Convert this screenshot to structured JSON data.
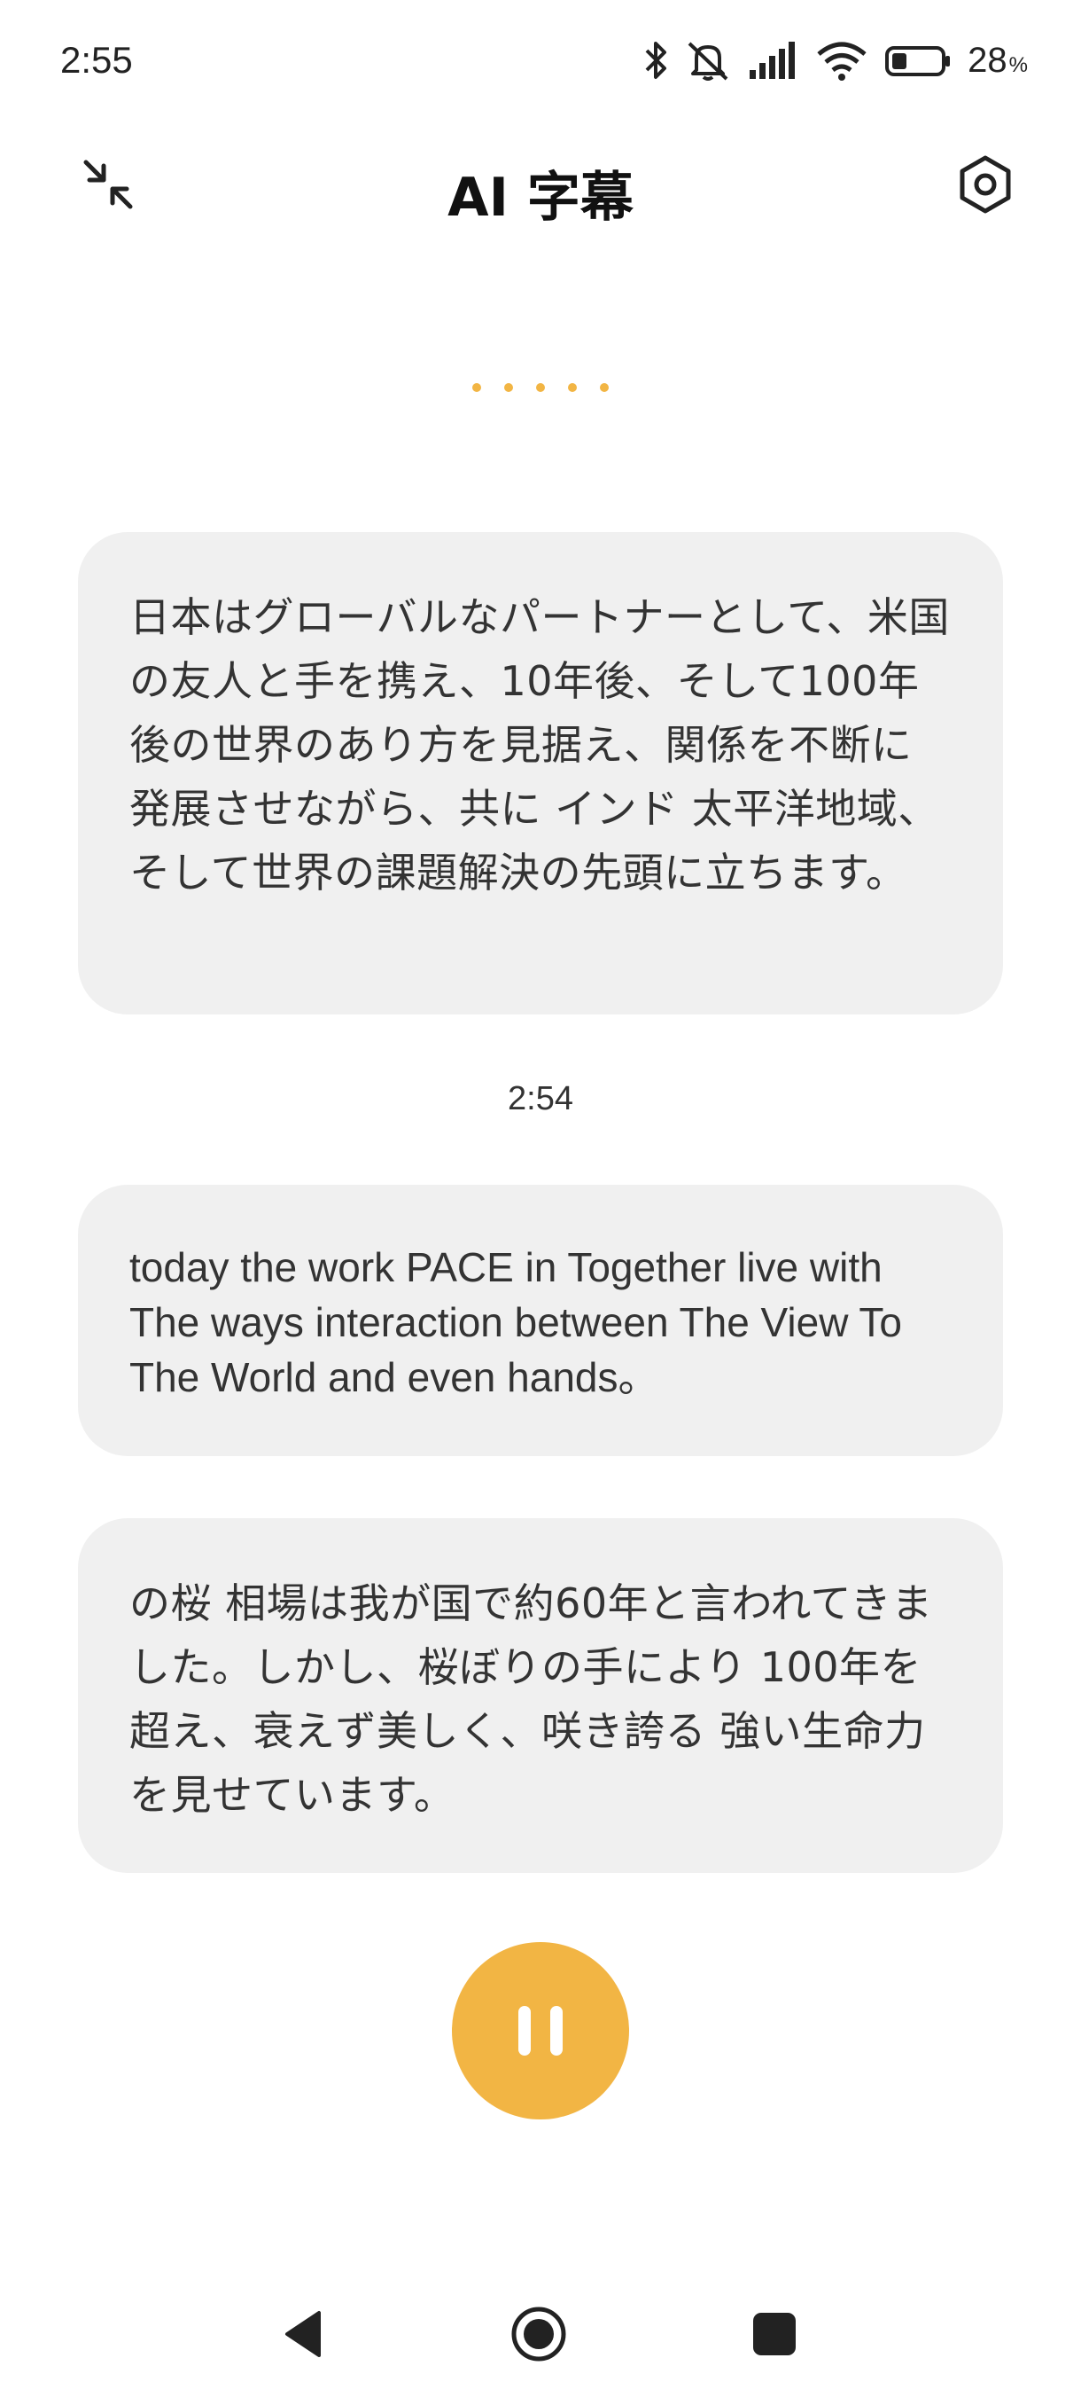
{
  "status_bar": {
    "time": "2:55",
    "battery_percent": "28",
    "battery_unit": "%",
    "icons": [
      "bluetooth-icon",
      "mute-icon",
      "signal-icon",
      "wifi-icon",
      "battery-icon"
    ]
  },
  "header": {
    "title": "AI 字幕",
    "left_icon": "collapse-icon",
    "right_icon": "settings-icon"
  },
  "listening_indicator": {
    "dot_count": 5,
    "color": "#f2b544"
  },
  "captions": [
    {
      "text": "日本はグローバルなパートナーとして、米国の友人と手を携え、10年後、そして100年後の世界のあり方を見据え、関係を不断に発展させながら、共に インド 太平洋地域、そして世界の課題解決の先頭に立ちます。"
    },
    {
      "timestamp": "2:54",
      "text": "today the work PACE in Together live with The ways interaction between The View To The World and even hands。"
    },
    {
      "text": " の桜 相場は我が国で約60年と言われてきました。しかし、桜ぼりの手により 100年を超え、衰えず美しく、咲き誇る 強い生命力を見せています。"
    }
  ],
  "controls": {
    "pause_icon": "pause-icon",
    "accent_color": "#f2b544"
  },
  "nav_bar": {
    "icons": [
      "back-icon",
      "home-icon",
      "recents-icon"
    ]
  }
}
